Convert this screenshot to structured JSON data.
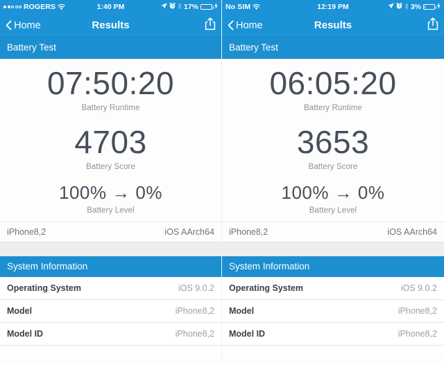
{
  "panels": [
    {
      "id": "left",
      "status": {
        "carrier": "ROGERS",
        "signal_dots_filled": 2,
        "signal_dots_total": 5,
        "wifi_icon": "wifi-icon",
        "time": "1:40 PM",
        "location_icon": "location-arrow-icon",
        "alarm_icon": "alarm-clock-icon",
        "bluetooth_icon": "bluetooth-icon",
        "battery_percent": "17%",
        "battery_fill_ratio": 0.17,
        "battery_color": "#ee3b30",
        "charging_icon": "lightning-bolt-icon"
      },
      "nav": {
        "back_label": "Home",
        "back_icon": "chevron-left-icon",
        "title": "Results",
        "share_icon": "share-icon"
      },
      "section_title": "Battery Test",
      "metrics": [
        {
          "value": "07:50:20",
          "caption": "Battery Runtime"
        },
        {
          "value": "4703",
          "caption": "Battery Score"
        },
        {
          "value": "100% → 0%",
          "caption": "Battery Level"
        }
      ],
      "device": {
        "model": "iPhone8,2",
        "platform": "iOS AArch64"
      },
      "info_title": "System Information",
      "info_rows": [
        {
          "key": "Operating System",
          "value": "iOS 9.0.2"
        },
        {
          "key": "Model",
          "value": "iPhone8,2"
        },
        {
          "key": "Model ID",
          "value": "iPhone8,2"
        }
      ]
    },
    {
      "id": "right",
      "status": {
        "carrier": "No SIM",
        "signal_dots_filled": 0,
        "signal_dots_total": 0,
        "wifi_icon": "wifi-icon",
        "time": "12:19 PM",
        "location_icon": "location-arrow-icon",
        "alarm_icon": "alarm-clock-icon",
        "bluetooth_icon": "bluetooth-icon",
        "battery_percent": "3%",
        "battery_fill_ratio": 0.03,
        "battery_color": "#ffffff",
        "charging_icon": "lightning-bolt-icon"
      },
      "nav": {
        "back_label": "Home",
        "back_icon": "chevron-left-icon",
        "title": "Results",
        "share_icon": "share-icon"
      },
      "section_title": "Battery Test",
      "metrics": [
        {
          "value": "06:05:20",
          "caption": "Battery Runtime"
        },
        {
          "value": "3653",
          "caption": "Battery Score"
        },
        {
          "value": "100% → 0%",
          "caption": "Battery Level"
        }
      ],
      "device": {
        "model": "iPhone8,2",
        "platform": "iOS AArch64"
      },
      "info_title": "System Information",
      "info_rows": [
        {
          "key": "Operating System",
          "value": "iOS 9.0.2"
        },
        {
          "key": "Model",
          "value": "iPhone8,2"
        },
        {
          "key": "Model ID",
          "value": "iPhone8,2"
        }
      ]
    }
  ],
  "colors": {
    "status_bar_blue": "#1b93d6",
    "nav_bar_blue": "#1b93d6",
    "section_header_blue": "#1b8fd0",
    "metric_text": "#464f5a",
    "caption_text": "#8b9199",
    "battery_low_red": "#ee3b30"
  }
}
